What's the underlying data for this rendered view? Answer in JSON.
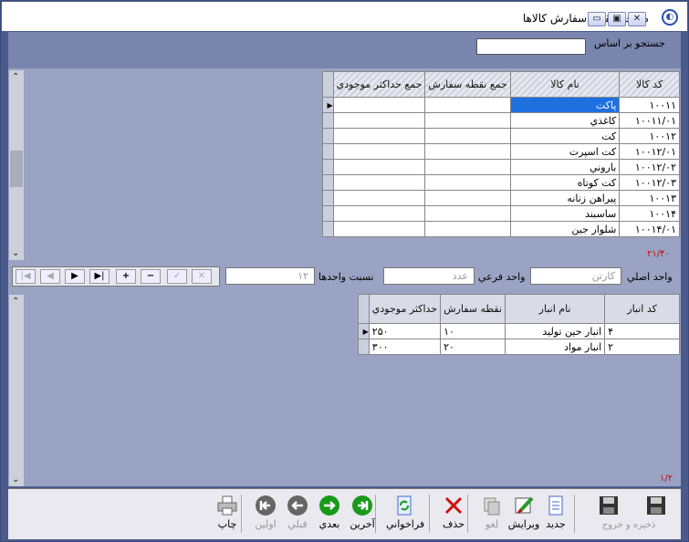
{
  "window": {
    "title": "معرفي نقطه سفارش كالاها",
    "min": "▭",
    "restore": "▣",
    "close": "✕",
    "sys_icon": "app-icon"
  },
  "search": {
    "label": "جستجو بر اساس",
    "value": ""
  },
  "grid1": {
    "columns": [
      "كد كالا",
      "نام كالا",
      "جمع نقطه سفارش",
      "جمع حداكثر موجودي"
    ],
    "rows": [
      {
        "code": "۱۰۰۱۱",
        "name": "پاكت",
        "sum_order": "",
        "sum_max": ""
      },
      {
        "code": "۱۰۰۱۱/۰۱",
        "name": "كاغذي",
        "sum_order": "",
        "sum_max": ""
      },
      {
        "code": "۱۰۰۱۲",
        "name": "كت",
        "sum_order": "",
        "sum_max": ""
      },
      {
        "code": "۱۰۰۱۲/۰۱",
        "name": "كت اسپرت",
        "sum_order": "",
        "sum_max": ""
      },
      {
        "code": "۱۰۰۱۲/۰۲",
        "name": "باروني",
        "sum_order": "",
        "sum_max": ""
      },
      {
        "code": "۱۰۰۱۲/۰۳",
        "name": "كت كوتاه",
        "sum_order": "",
        "sum_max": ""
      },
      {
        "code": "۱۰۰۱۳",
        "name": "پيراهن زنانه",
        "sum_order": "",
        "sum_max": ""
      },
      {
        "code": "۱۰۰۱۴",
        "name": "ساسبند",
        "sum_order": "",
        "sum_max": ""
      },
      {
        "code": "۱۰۰۱۴/۰۱",
        "name": "شلوار جين",
        "sum_order": "",
        "sum_max": ""
      }
    ],
    "counter": "۲۱/۴۰"
  },
  "units": {
    "main_label": "واحد اصلي",
    "main_value": "كارتن",
    "sub_label": "واحد فرعي",
    "sub_value": "عدد",
    "ratio_label": "نسبت واحدها",
    "ratio_value": "۱۲"
  },
  "nav": {
    "first": "|◀",
    "prev": "◀",
    "next": "▶",
    "last": "▶|",
    "add": "+",
    "remove": "−",
    "ok": "✓",
    "cancel": "✕"
  },
  "grid2": {
    "columns": [
      "كد انبار",
      "نام انبار",
      "نقطه سفارش",
      "حداكثر موجودي"
    ],
    "rows": [
      {
        "code": "۴",
        "name": "انبار حين توليد",
        "order": "۱۰",
        "max": "۲۵۰"
      },
      {
        "code": "۲",
        "name": "انبار مواد",
        "order": "۲۰",
        "max": "۳۰۰"
      }
    ],
    "counter": "۱/۲"
  },
  "toolbar": {
    "save_exit": "ذخيره و خروج",
    "save": "ذخيره",
    "new": "جديد",
    "edit": "ويرايش",
    "undo": "لغو",
    "delete": "حذف",
    "refresh": "فراخواني",
    "last": "آخرين",
    "next": "بعدي",
    "prev": "قبلي",
    "first": "اولين",
    "print": "چاپ"
  }
}
